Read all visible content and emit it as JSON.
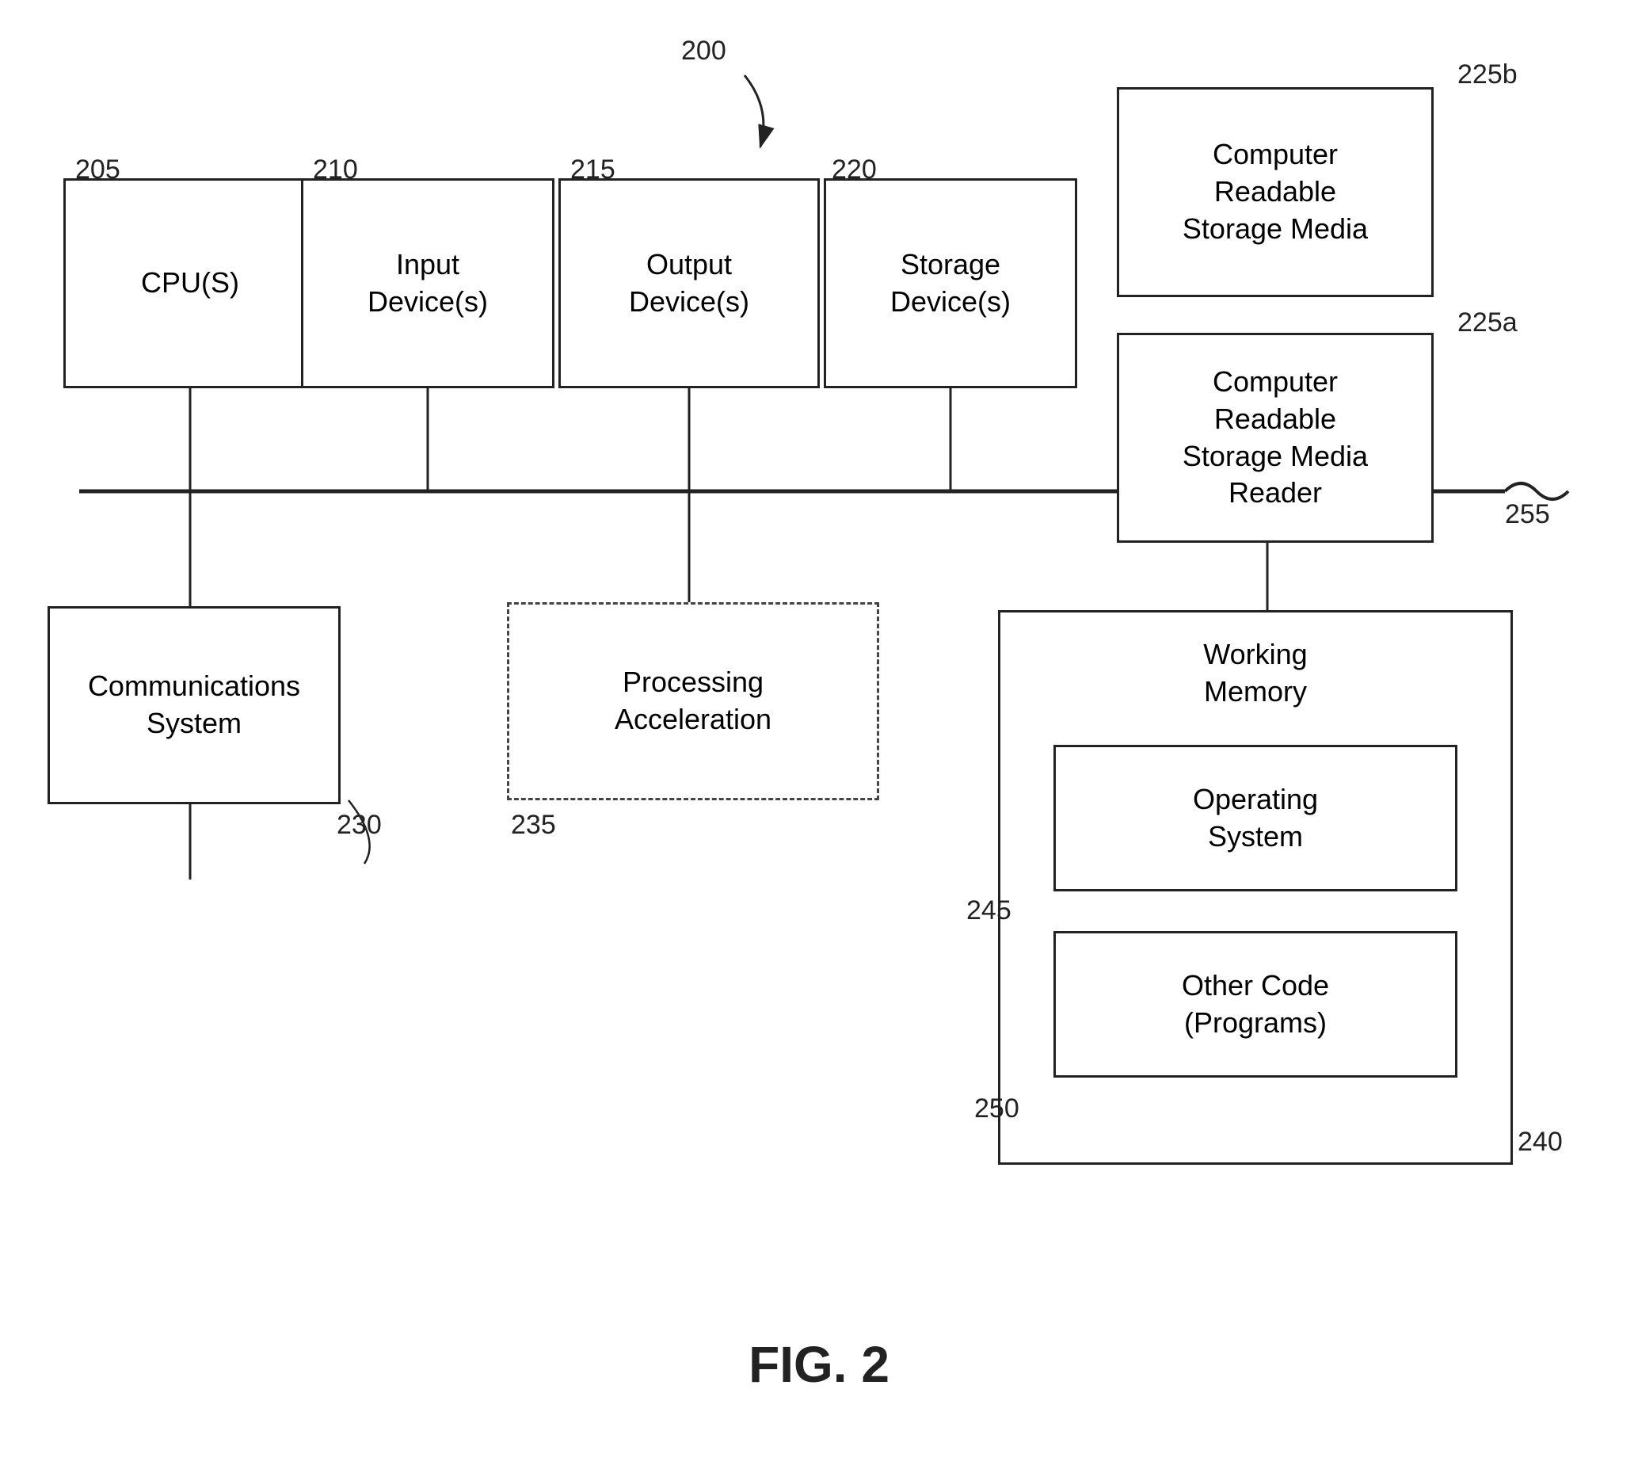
{
  "diagram": {
    "title": "200",
    "figure_label": "FIG. 2",
    "boxes": {
      "cpu": {
        "label": "CPU(S)",
        "ref": "205"
      },
      "input_device": {
        "label": "Input\nDevice(s)",
        "ref": "210"
      },
      "output_device": {
        "label": "Output\nDevice(s)",
        "ref": "215"
      },
      "storage_device": {
        "label": "Storage\nDevice(s)",
        "ref": "220"
      },
      "crsm_reader": {
        "label": "Computer\nReadable\nStorage Media\nReader",
        "ref": "225a"
      },
      "crsm": {
        "label": "Computer\nReadable\nStorage Media",
        "ref": "225b"
      },
      "comm_system": {
        "label": "Communications\nSystem",
        "ref": "230"
      },
      "proc_accel": {
        "label": "Processing\nAcceleration",
        "ref": "235"
      },
      "working_memory": {
        "label": "Working\nMemory",
        "ref": "240"
      },
      "operating_system": {
        "label": "Operating\nSystem",
        "ref": "245"
      },
      "other_code": {
        "label": "Other Code\n(Programs)",
        "ref": "250"
      },
      "bus": {
        "ref": "255"
      }
    }
  }
}
